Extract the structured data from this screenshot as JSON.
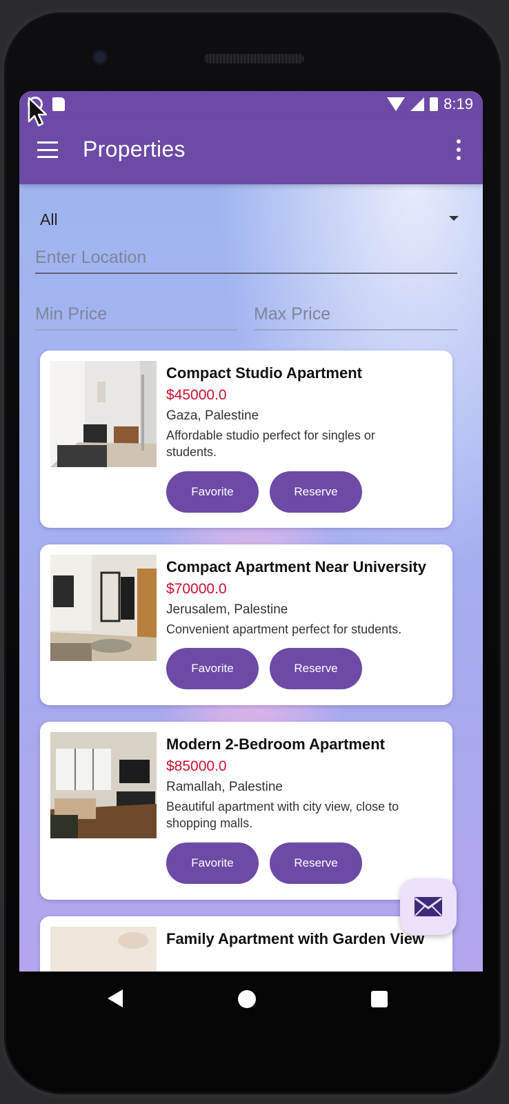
{
  "status_bar": {
    "time": "8:19"
  },
  "app_bar": {
    "title": "Properties"
  },
  "filters": {
    "type_selected": "All",
    "location_placeholder": "Enter Location",
    "min_price_placeholder": "Min Price",
    "max_price_placeholder": "Max Price"
  },
  "listings": [
    {
      "title": "Compact Studio Apartment",
      "price": "$45000.0",
      "location": "Gaza, Palestine",
      "description": "Affordable studio perfect for singles or students.",
      "favorite_label": "Favorite",
      "reserve_label": "Reserve"
    },
    {
      "title": "Compact Apartment Near University",
      "price": "$70000.0",
      "location": "Jerusalem, Palestine",
      "description": "Convenient apartment perfect for students.",
      "favorite_label": "Favorite",
      "reserve_label": "Reserve"
    },
    {
      "title": "Modern 2-Bedroom Apartment",
      "price": "$85000.0",
      "location": "Ramallah, Palestine",
      "description": "Beautiful apartment with city view, close to shopping malls.",
      "favorite_label": "Favorite",
      "reserve_label": "Reserve"
    },
    {
      "title": "Family Apartment with Garden View"
    }
  ],
  "fab": {
    "icon": "mail-icon"
  },
  "nav_bar": {
    "icons": [
      "back-icon",
      "home-icon",
      "recents-icon"
    ]
  },
  "colors": {
    "primary": "#6C4AA6",
    "price": "#C8102E",
    "fab_bg": "#ECE0FB"
  }
}
